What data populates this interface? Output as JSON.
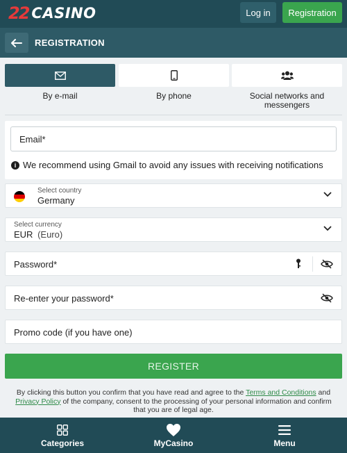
{
  "header": {
    "logo_number": "22",
    "logo_text": "CASINO",
    "login_label": "Log in",
    "registration_label": "Registration"
  },
  "subheader": {
    "title": "REGISTRATION"
  },
  "tabs": [
    {
      "label": "By e-mail",
      "icon": "envelope-icon",
      "active": true
    },
    {
      "label": "By phone",
      "icon": "phone-icon",
      "active": false
    },
    {
      "label": "Social networks and messengers",
      "icon": "users-icon",
      "active": false
    }
  ],
  "form": {
    "email_placeholder": "Email*",
    "gmail_note": "We recommend using Gmail to avoid any issues with receiving notifications",
    "country_label": "Select country",
    "country_value": "Germany",
    "currency_label": "Select currency",
    "currency_code": "EUR",
    "currency_name": "(Euro)",
    "password_placeholder": "Password*",
    "reenter_placeholder": "Re-enter your password*",
    "promo_placeholder": "Promo code (if you have one)",
    "register_label": "REGISTER"
  },
  "legal": {
    "part1": "By clicking this button you confirm that you have read and agree to the ",
    "terms_link": "Terms and Conditions",
    "part2": " and ",
    "privacy_link": "Privacy Policy",
    "part3": " of the company, consent to the processing of your personal information and confirm that you are of legal age."
  },
  "bottom_nav": [
    {
      "label": "Categories",
      "icon": "grid-icon"
    },
    {
      "label": "MyCasino",
      "icon": "heart-icon"
    },
    {
      "label": "Menu",
      "icon": "hamburger-icon"
    }
  ],
  "colors": {
    "header_bg": "#214b56",
    "subheader_bg": "#2e5a66",
    "accent_green": "#3aa54e",
    "page_bg": "#eef1f3"
  }
}
